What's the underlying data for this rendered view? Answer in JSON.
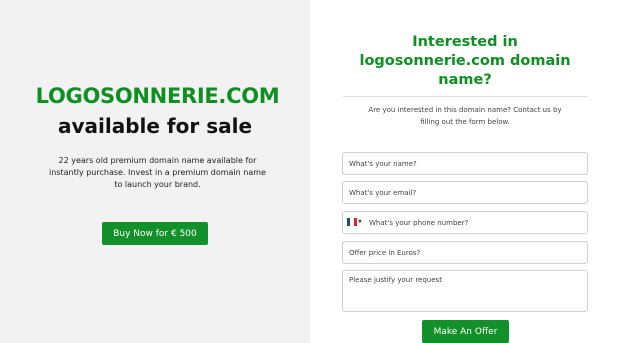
{
  "left": {
    "domain_title": "LOGOSONNERIE.COM",
    "availability": "available for sale",
    "description": "22 years old premium domain name available for instantly purchase. Invest in a premium domain name to launch your brand.",
    "buy_button": "Buy Now for € 500"
  },
  "right": {
    "heading": "Interested in logosonnerie.com domain name?",
    "contact_text": "Are you interested in this domain name? Contact us by filling out the form below.",
    "form": {
      "name_placeholder": "What's your name?",
      "email_placeholder": "What's your email?",
      "phone_placeholder": "What's your phone number?",
      "phone_country_icon": "france-flag-icon",
      "offer_placeholder": "Offer price in Euros?",
      "request_placeholder": "Please justify your request",
      "submit_button": "Make An Offer"
    }
  },
  "colors": {
    "accent_green": "#0e8f22",
    "button_green": "#12902a",
    "left_background": "#f2f2f2"
  }
}
